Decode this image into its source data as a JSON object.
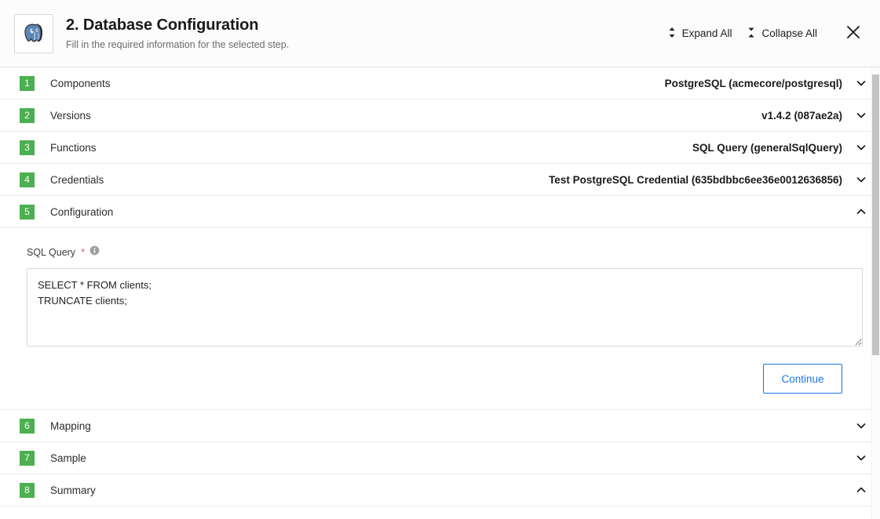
{
  "header": {
    "logo_icon": "postgresql-elephant-icon",
    "title": "2. Database Configuration",
    "subtitle": "Fill in the required information for the selected step.",
    "expand_all_label": "Expand All",
    "collapse_all_label": "Collapse All",
    "expand_all_icon": "expand-vertical-icon",
    "collapse_all_icon": "collapse-vertical-icon",
    "close_icon": "close-icon"
  },
  "accent_colors": {
    "badge_green": "#4caf50",
    "link_blue": "#1a73e8",
    "required_red": "#e8506e",
    "divider": "#ececed"
  },
  "steps": [
    {
      "number": "1",
      "label": "Components",
      "value": "PostgreSQL (acmecore/postgresql)",
      "chevron": "chevron-down-icon",
      "expanded": false
    },
    {
      "number": "2",
      "label": "Versions",
      "value": "v1.4.2 (087ae2a)",
      "chevron": "chevron-down-icon",
      "expanded": false
    },
    {
      "number": "3",
      "label": "Functions",
      "value": "SQL Query (generalSqlQuery)",
      "chevron": "chevron-down-icon",
      "expanded": false
    },
    {
      "number": "4",
      "label": "Credentials",
      "value": "Test PostgreSQL Credential (635bdbbc6ee36e0012636856)",
      "chevron": "chevron-down-icon",
      "expanded": false
    },
    {
      "number": "5",
      "label": "Configuration",
      "value": "",
      "chevron": "chevron-up-icon",
      "expanded": true
    },
    {
      "number": "6",
      "label": "Mapping",
      "value": "",
      "chevron": "chevron-down-icon",
      "expanded": false
    },
    {
      "number": "7",
      "label": "Sample",
      "value": "",
      "chevron": "chevron-down-icon",
      "expanded": false
    },
    {
      "number": "8",
      "label": "Summary",
      "value": "",
      "chevron": "chevron-up-icon",
      "expanded": false
    }
  ],
  "configuration_panel": {
    "field_label": "SQL Query",
    "required_marker": "*",
    "info_icon": "info-icon",
    "sql_value": "SELECT * FROM clients;\nTRUNCATE clients;",
    "sql_placeholder": "",
    "continue_label": "Continue"
  },
  "scrollbar": {
    "name": "vertical-scrollbar"
  }
}
